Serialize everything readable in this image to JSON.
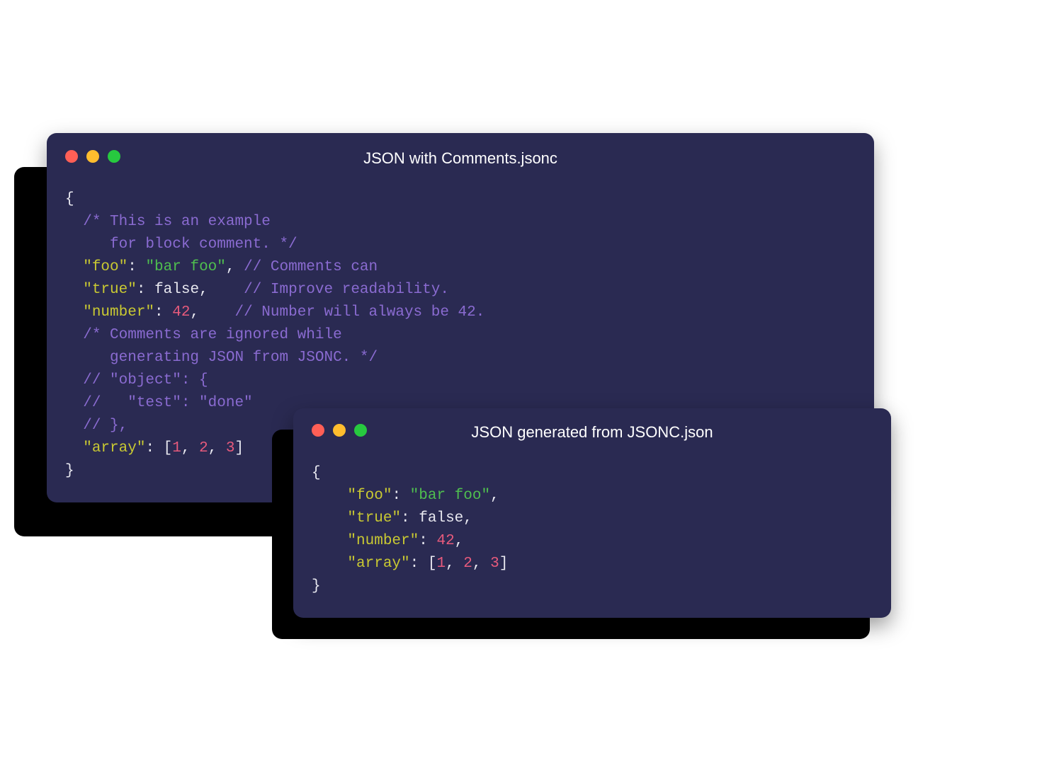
{
  "colors": {
    "window_bg": "#2a2a52",
    "traffic_red": "#ff5f56",
    "traffic_yellow": "#ffbd2e",
    "traffic_green": "#27c93f",
    "key": "#c9c932",
    "string": "#4fbf4f",
    "number": "#e75a7c",
    "comment": "#8a6bd1",
    "punct": "#e8e8f0"
  },
  "back_window": {
    "title": "JSON with Comments.jsonc",
    "code": [
      [
        {
          "t": "punct",
          "v": "{"
        }
      ],
      [
        {
          "t": "pad",
          "v": "  "
        },
        {
          "t": "comment",
          "v": "/* This is an example"
        }
      ],
      [
        {
          "t": "pad",
          "v": "     "
        },
        {
          "t": "comment",
          "v": "for block comment. */"
        }
      ],
      [
        {
          "t": "pad",
          "v": "  "
        },
        {
          "t": "key",
          "v": "\"foo\""
        },
        {
          "t": "punct",
          "v": ": "
        },
        {
          "t": "str",
          "v": "\"bar foo\""
        },
        {
          "t": "punct",
          "v": ", "
        },
        {
          "t": "comment",
          "v": "// Comments can"
        }
      ],
      [
        {
          "t": "pad",
          "v": "  "
        },
        {
          "t": "key",
          "v": "\"true\""
        },
        {
          "t": "punct",
          "v": ": "
        },
        {
          "t": "bool",
          "v": "false"
        },
        {
          "t": "punct",
          "v": ",    "
        },
        {
          "t": "comment",
          "v": "// Improve readability."
        }
      ],
      [
        {
          "t": "pad",
          "v": "  "
        },
        {
          "t": "key",
          "v": "\"number\""
        },
        {
          "t": "punct",
          "v": ": "
        },
        {
          "t": "num",
          "v": "42"
        },
        {
          "t": "punct",
          "v": ",    "
        },
        {
          "t": "comment",
          "v": "// Number will always be 42."
        }
      ],
      [
        {
          "t": "pad",
          "v": "  "
        },
        {
          "t": "comment",
          "v": "/* Comments are ignored while"
        }
      ],
      [
        {
          "t": "pad",
          "v": "     "
        },
        {
          "t": "comment",
          "v": "generating JSON from JSONC. */"
        }
      ],
      [
        {
          "t": "pad",
          "v": "  "
        },
        {
          "t": "comment",
          "v": "// \"object\": {"
        }
      ],
      [
        {
          "t": "pad",
          "v": "  "
        },
        {
          "t": "comment",
          "v": "//   \"test\": \"done\""
        }
      ],
      [
        {
          "t": "pad",
          "v": "  "
        },
        {
          "t": "comment",
          "v": "// },"
        }
      ],
      [
        {
          "t": "pad",
          "v": "  "
        },
        {
          "t": "key",
          "v": "\"array\""
        },
        {
          "t": "punct",
          "v": ": ["
        },
        {
          "t": "num",
          "v": "1"
        },
        {
          "t": "punct",
          "v": ", "
        },
        {
          "t": "num",
          "v": "2"
        },
        {
          "t": "punct",
          "v": ", "
        },
        {
          "t": "num",
          "v": "3"
        },
        {
          "t": "punct",
          "v": "]"
        }
      ],
      [
        {
          "t": "punct",
          "v": "}"
        }
      ]
    ]
  },
  "front_window": {
    "title": "JSON generated from JSONC.json",
    "code": [
      [
        {
          "t": "punct",
          "v": "{"
        }
      ],
      [
        {
          "t": "pad",
          "v": "    "
        },
        {
          "t": "key",
          "v": "\"foo\""
        },
        {
          "t": "punct",
          "v": ": "
        },
        {
          "t": "str",
          "v": "\"bar foo\""
        },
        {
          "t": "punct",
          "v": ","
        }
      ],
      [
        {
          "t": "pad",
          "v": "    "
        },
        {
          "t": "key",
          "v": "\"true\""
        },
        {
          "t": "punct",
          "v": ": "
        },
        {
          "t": "bool",
          "v": "false"
        },
        {
          "t": "punct",
          "v": ","
        }
      ],
      [
        {
          "t": "pad",
          "v": "    "
        },
        {
          "t": "key",
          "v": "\"number\""
        },
        {
          "t": "punct",
          "v": ": "
        },
        {
          "t": "num",
          "v": "42"
        },
        {
          "t": "punct",
          "v": ","
        }
      ],
      [
        {
          "t": "pad",
          "v": "    "
        },
        {
          "t": "key",
          "v": "\"array\""
        },
        {
          "t": "punct",
          "v": ": ["
        },
        {
          "t": "num",
          "v": "1"
        },
        {
          "t": "punct",
          "v": ", "
        },
        {
          "t": "num",
          "v": "2"
        },
        {
          "t": "punct",
          "v": ", "
        },
        {
          "t": "num",
          "v": "3"
        },
        {
          "t": "punct",
          "v": "]"
        }
      ],
      [
        {
          "t": "punct",
          "v": "}"
        }
      ]
    ]
  }
}
